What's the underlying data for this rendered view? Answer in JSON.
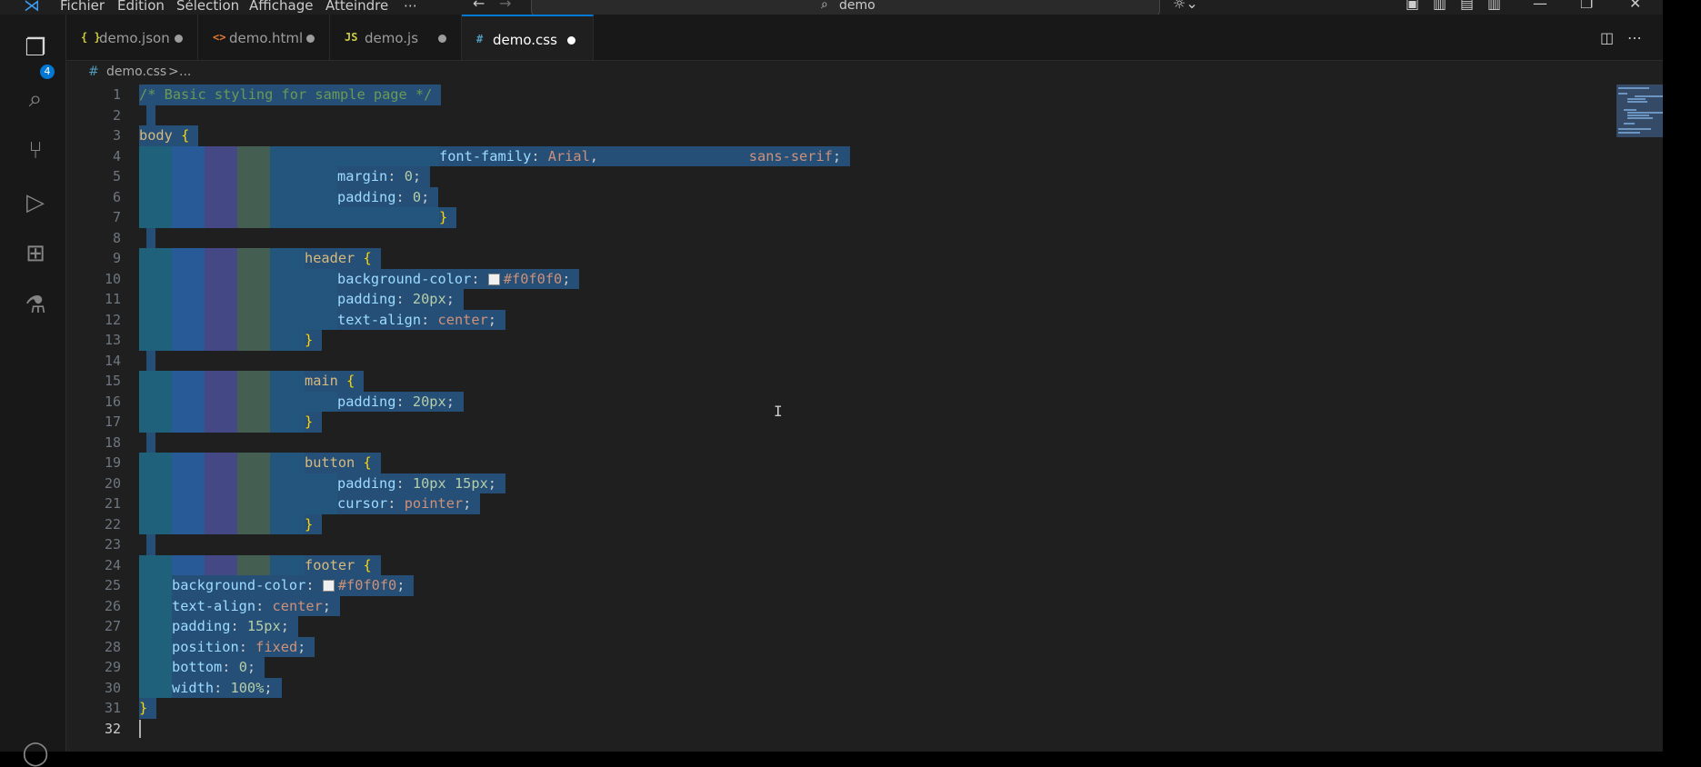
{
  "menu": {
    "items": [
      "Fichier",
      "Edition",
      "Sélection",
      "Affichage",
      "Atteindre",
      "⋯"
    ]
  },
  "search": {
    "text": "demo"
  },
  "activity_bar": {
    "explorer_badge": "4",
    "icons": [
      "files-icon",
      "search-icon",
      "source-control-icon",
      "run-debug-icon",
      "extensions-icon",
      "testing-icon"
    ]
  },
  "tabs": [
    {
      "label": "demo.json",
      "icon": "{ }",
      "icon_color": "#cbcb41",
      "dirty": true,
      "active": false
    },
    {
      "label": "demo.html",
      "icon": "<>",
      "icon_color": "#e37933",
      "dirty": true,
      "active": false
    },
    {
      "label": "demo.js",
      "icon": "JS",
      "icon_color": "#cbcb41",
      "dirty": true,
      "active": false
    },
    {
      "label": "demo.css",
      "icon": "#",
      "icon_color": "#519aba",
      "dirty": true,
      "active": true
    }
  ],
  "breadcrumbs": {
    "file": "demo.css",
    "separator": ">",
    "more": "..."
  },
  "editor": {
    "line_numbers": [
      "1",
      "2",
      "3",
      "4",
      "5",
      "6",
      "7",
      "8",
      "9",
      "10",
      "11",
      "12",
      "13",
      "14",
      "15",
      "16",
      "17",
      "18",
      "19",
      "20",
      "21",
      "22",
      "23",
      "24",
      "25",
      "26",
      "27",
      "28",
      "29",
      "30",
      "31",
      "32"
    ],
    "code": {
      "l1": "/* Basic styling for sample page */",
      "l3_sel": "body",
      "l3_brace": "{",
      "l4_prop": "font-family",
      "l4_val1": "Arial",
      "l4_val2": "sans-serif",
      "l5_prop": "margin",
      "l5_val": "0",
      "l6_prop": "padding",
      "l6_val": "0",
      "close": "}",
      "l9_sel": "header",
      "l10_prop": "background-color",
      "l10_val": "#f0f0f0",
      "l11_prop": "padding",
      "l11_val": "20px",
      "l12_prop": "text-align",
      "l12_val": "center",
      "l15_sel": "main",
      "l16_prop": "padding",
      "l16_val": "20px",
      "l19_sel": "button",
      "l20_prop": "padding",
      "l20_val": "10px 15px",
      "l21_prop": "cursor",
      "l21_val": "pointer",
      "l24_sel": "footer",
      "l25_prop": "background-color",
      "l25_val": "#f0f0f0",
      "l26_prop": "text-align",
      "l26_val": "center",
      "l27_prop": "padding",
      "l27_val": "15px",
      "l28_prop": "position",
      "l28_val": "fixed",
      "l29_prop": "bottom",
      "l29_val": "0",
      "l30_prop": "width",
      "l30_val": "100%"
    }
  },
  "colors": {
    "selection": "#264f78",
    "accent": "#0078d4",
    "comment": "#6a9955",
    "selector": "#d7ba7d",
    "property": "#9cdcfe",
    "value": "#ce9178",
    "number": "#b5cea8"
  }
}
